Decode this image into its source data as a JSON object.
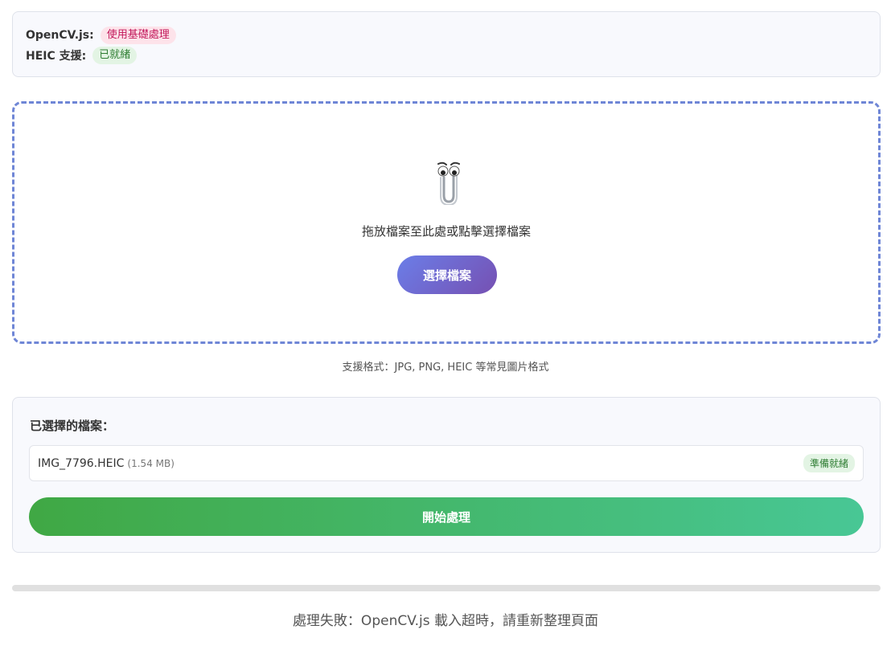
{
  "status": {
    "opencv_label": "OpenCV.js:",
    "opencv_value": "使用基礎處理",
    "heic_label": "HEIC 支援:",
    "heic_value": "已就緒"
  },
  "dropzone": {
    "icon": "paperclip-icon",
    "instruction": "拖放檔案至此處或點擊選擇檔案",
    "choose_button": "選擇檔案"
  },
  "formats_note": "支援格式：JPG, PNG, HEIC 等常見圖片格式",
  "selected": {
    "title": "已選擇的檔案：",
    "files": [
      {
        "name": "IMG_7796.HEIC",
        "size": "(1.54 MB)",
        "status": "準備就緒"
      }
    ],
    "start_button": "開始處理"
  },
  "progress": {
    "value": 0
  },
  "error_message": "處理失敗：OpenCV.js 載入超時，請重新整理頁面",
  "colors": {
    "accent_start": "#6b7ee8",
    "accent_end": "#7650b2",
    "success": "#40a844",
    "warning_pill": "#c2185b"
  }
}
